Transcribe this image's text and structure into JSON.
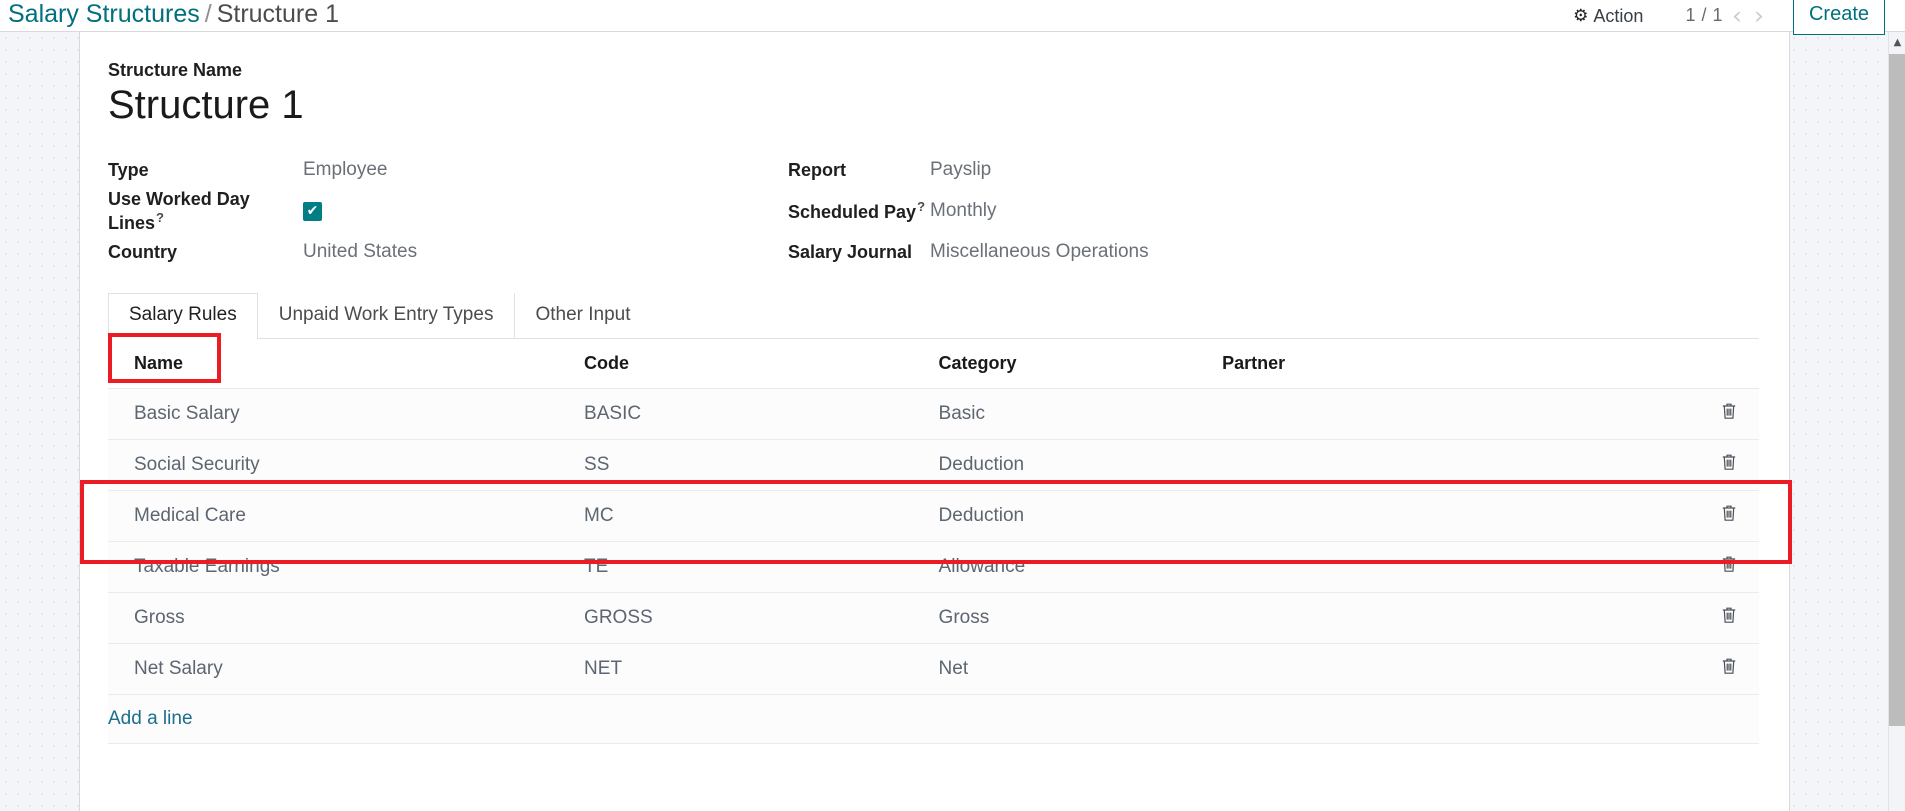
{
  "breadcrumb": {
    "parent": "Salary Structures",
    "separator": "/",
    "current": "Structure 1"
  },
  "control_panel": {
    "action_label": "Action",
    "action_icon": "gear-icon",
    "pager_counter": "1 / 1",
    "prev_icon": "chevron-left-icon",
    "next_icon": "chevron-right-icon",
    "create_label": "Create"
  },
  "form": {
    "title_label": "Structure Name",
    "title_value": "Structure 1",
    "left_fields": [
      {
        "label": "Type",
        "value": "Employee",
        "help": false,
        "type": "text"
      },
      {
        "label": "Use Worked Day Lines",
        "value": "",
        "help": true,
        "type": "checkbox",
        "checked": true
      },
      {
        "label": "Country",
        "value": "United States",
        "help": false,
        "type": "text"
      }
    ],
    "right_fields": [
      {
        "label": "Report",
        "value": "Payslip",
        "help": false,
        "type": "text"
      },
      {
        "label": "Scheduled Pay",
        "value": "Monthly",
        "help": true,
        "type": "text"
      },
      {
        "label": "Salary Journal",
        "value": "Miscellaneous Operations",
        "help": false,
        "type": "text"
      }
    ],
    "help_marker": "?"
  },
  "notebook": {
    "tabs": [
      {
        "label": "Salary Rules",
        "active": true
      },
      {
        "label": "Unpaid Work Entry Types",
        "active": false
      },
      {
        "label": "Other Input",
        "active": false
      }
    ]
  },
  "table": {
    "headers": [
      "Name",
      "Code",
      "Category",
      "Partner"
    ],
    "rows": [
      {
        "name": "Basic Salary",
        "code": "BASIC",
        "category": "Basic",
        "partner": ""
      },
      {
        "name": "Social Security",
        "code": "SS",
        "category": "Deduction",
        "partner": ""
      },
      {
        "name": "Medical Care",
        "code": "MC",
        "category": "Deduction",
        "partner": ""
      },
      {
        "name": "Taxable Earnings",
        "code": "TE",
        "category": "Allowance",
        "partner": ""
      },
      {
        "name": "Gross",
        "code": "GROSS",
        "category": "Gross",
        "partner": ""
      },
      {
        "name": "Net Salary",
        "code": "NET",
        "category": "Net",
        "partner": ""
      }
    ],
    "delete_icon": "trash-icon",
    "add_line_label": "Add a line"
  },
  "annotations": {
    "highlight_color": "#ec1c24",
    "boxes": [
      {
        "target": "tab-salary-rules"
      },
      {
        "target": "rows-social-security-medical-care"
      }
    ]
  },
  "scrollbar": {
    "up_arrow_icon": "triangle-up-icon"
  },
  "colors": {
    "brand_teal": "#00707f",
    "checkbox_teal": "#017e84",
    "link_blue": "#1c6e8c",
    "highlight_red": "#ec1c24",
    "page_bg": "#f4f5f8"
  }
}
